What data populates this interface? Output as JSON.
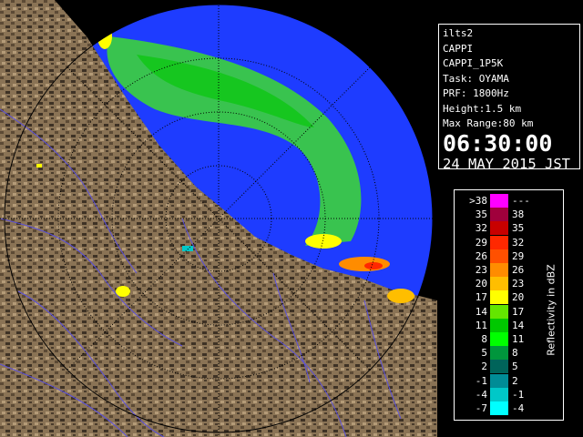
{
  "radar": {
    "station": "ilts2",
    "product": "CAPPI",
    "product_code": "CAPPI_1P5K",
    "task": "Task: OYAMA",
    "prf": "PRF: 1800Hz",
    "height": "Height:1.5 km",
    "max_range": "Max Range:80 km",
    "time": "06:30:00",
    "date": "24 MAY 2015 JST"
  },
  "legend": {
    "unit_label": "Reflectivity in dBZ",
    "rows": [
      {
        "lo": ">38",
        "hi": "---",
        "color": "#ff00ff"
      },
      {
        "lo": "35",
        "hi": "38",
        "color": "#a0003c"
      },
      {
        "lo": "32",
        "hi": "35",
        "color": "#c80000"
      },
      {
        "lo": "29",
        "hi": "32",
        "color": "#ff2800"
      },
      {
        "lo": "26",
        "hi": "29",
        "color": "#ff5000"
      },
      {
        "lo": "23",
        "hi": "26",
        "color": "#ff8c00"
      },
      {
        "lo": "20",
        "hi": "23",
        "color": "#ffbe00"
      },
      {
        "lo": "17",
        "hi": "20",
        "color": "#ffff00"
      },
      {
        "lo": "14",
        "hi": "17",
        "color": "#64e600"
      },
      {
        "lo": "11",
        "hi": "14",
        "color": "#00c800"
      },
      {
        "lo": "8",
        "hi": "11",
        "color": "#00ff00"
      },
      {
        "lo": "5",
        "hi": "8",
        "color": "#00963c"
      },
      {
        "lo": "2",
        "hi": "5",
        "color": "#00645a"
      },
      {
        "lo": "-1",
        "hi": "2",
        "color": "#008c96"
      },
      {
        "lo": "-4",
        "hi": "-1",
        "color": "#00c8c8"
      },
      {
        "lo": "-7",
        "hi": "-4",
        "color": "#00ffff"
      }
    ]
  },
  "colors": {
    "sea": "#1e3cff",
    "clear_air": "#1e64ff",
    "land": "#8a7355",
    "rivers": "#5a50dc",
    "range_rings": "#000000"
  }
}
